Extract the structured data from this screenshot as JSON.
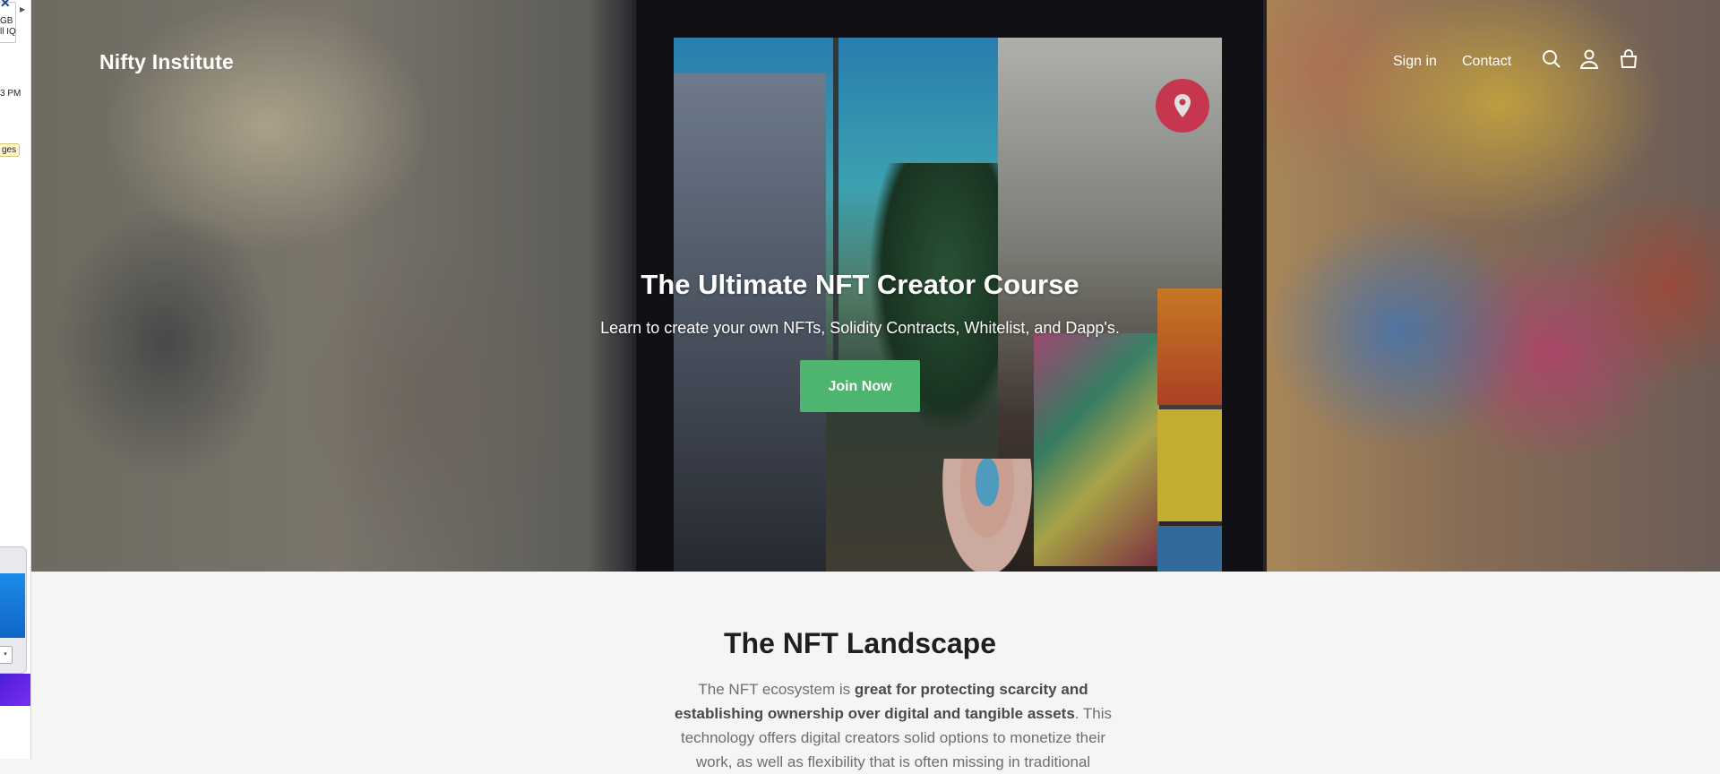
{
  "side_window": {
    "lines": [
      "GB",
      "ll IQ",
      "3 PM"
    ],
    "tag": "ges"
  },
  "header": {
    "logo": "Nifty Institute",
    "nav": {
      "signin": "Sign in",
      "contact": "Contact"
    },
    "icons": [
      "search-icon",
      "account-icon",
      "cart-icon"
    ]
  },
  "hero": {
    "title": "The Ultimate NFT Creator Course",
    "subtitle": "Learn to create your own NFTs, Solidity Contracts, Whitelist, and Dapp's.",
    "cta": "Join Now",
    "accent_color": "#4db56f"
  },
  "landscape": {
    "title": "The NFT Landscape",
    "body_intro": "The NFT ecosystem is ",
    "body_bold": "great for protecting scarcity and establishing ownership over digital and tangible assets",
    "body_rest": ". This technology offers digital creators solid options to monetize their work, as well as flexibility that is often missing in traditional"
  }
}
